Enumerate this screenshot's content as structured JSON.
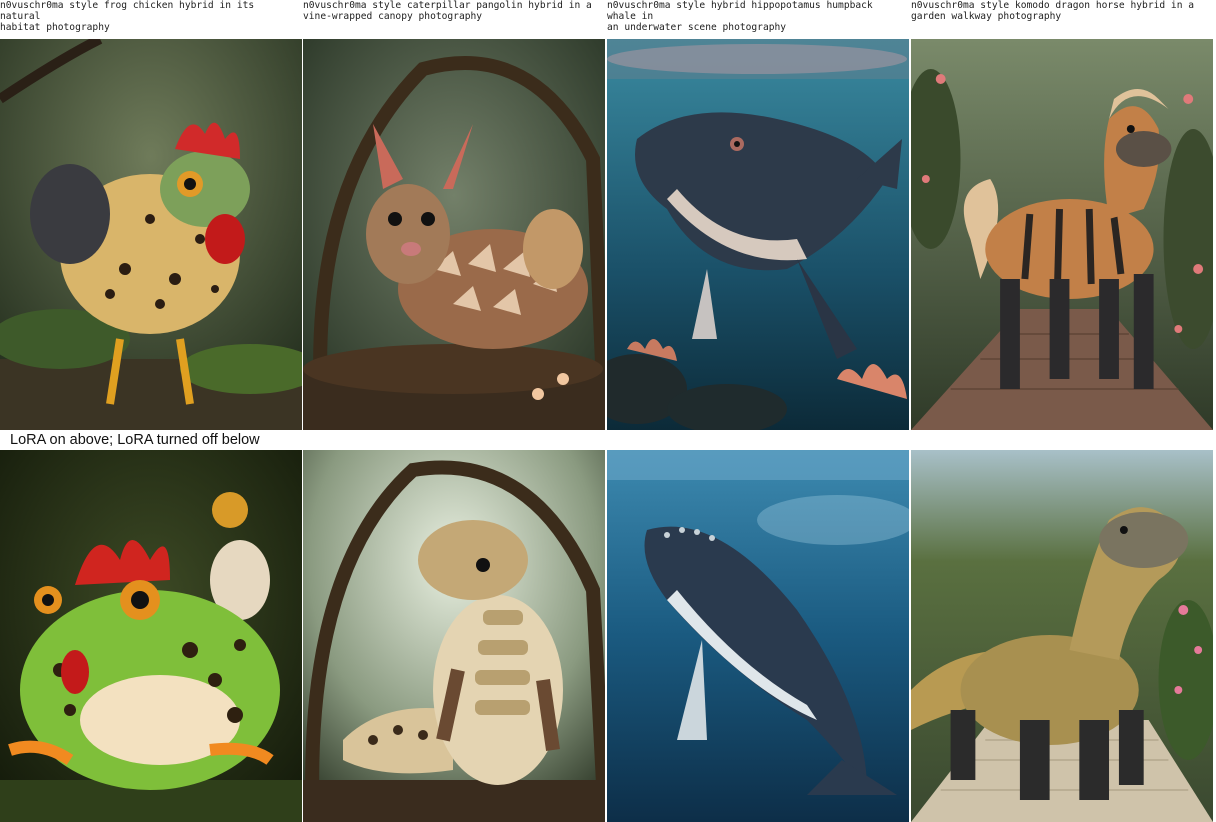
{
  "captions": [
    "n0vuschr0ma style frog chicken hybrid in its natural\nhabitat photography",
    "n0vuschr0ma style caterpillar pangolin hybrid in a\nvine-wrapped canopy photography",
    "n0vuschr0ma style hybrid hippopotamus humpback whale in\nan underwater scene photography",
    "n0vuschr0ma style komodo dragon horse hybrid in a\ngarden walkway photography"
  ],
  "divider_label": "LoRA on above; LoRA turned off below",
  "images_top": [
    {
      "subject": "frog-chicken-hybrid",
      "background": "#3d4a33"
    },
    {
      "subject": "caterpillar-pangolin-hybrid",
      "background": "#3a4535"
    },
    {
      "subject": "hippo-whale-hybrid",
      "background": "#1f5466"
    },
    {
      "subject": "komodo-horse-hybrid",
      "background": "#3f5038"
    }
  ],
  "images_bottom": [
    {
      "subject": "frog",
      "background": "#2f3a22"
    },
    {
      "subject": "pangolin",
      "background": "#6d7a66"
    },
    {
      "subject": "humpback-whale",
      "background": "#1d5a7a"
    },
    {
      "subject": "komodo-dragon",
      "background": "#5c6a48"
    }
  ]
}
